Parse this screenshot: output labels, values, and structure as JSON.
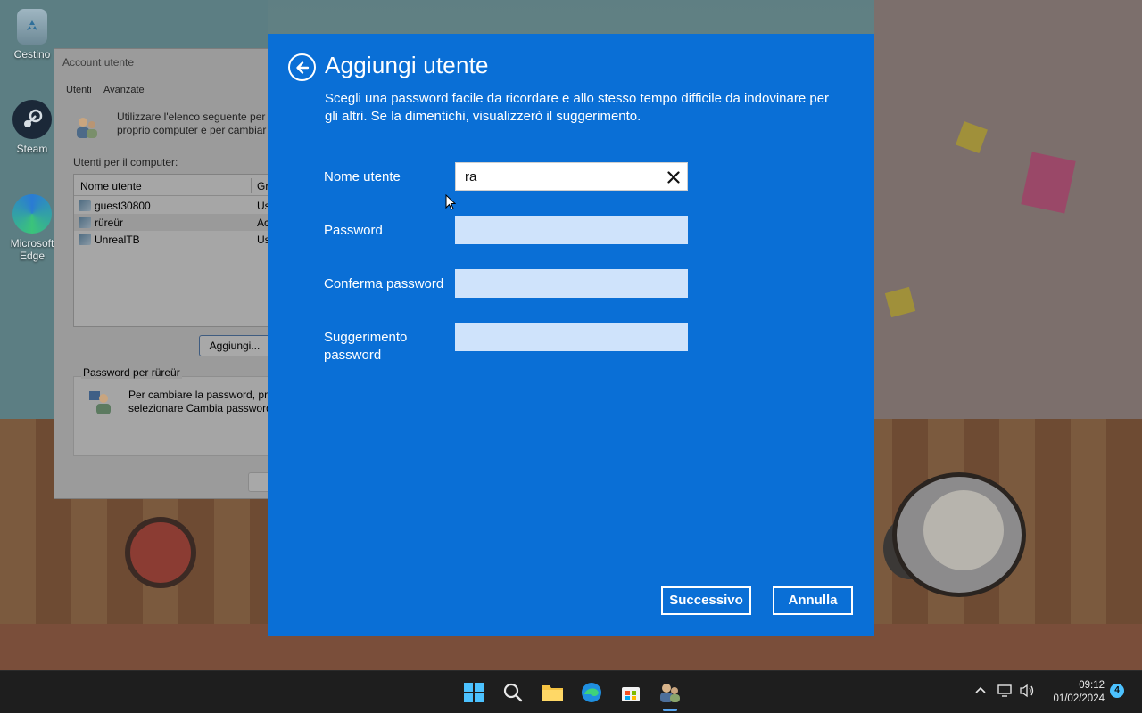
{
  "desktop": {
    "icons": [
      {
        "label": "Cestino",
        "icon": "recycle-bin-icon"
      },
      {
        "label": "Steam",
        "icon": "steam-icon"
      },
      {
        "label": "Microsoft Edge",
        "icon": "edge-icon"
      }
    ]
  },
  "account_window": {
    "title": "Account utente",
    "tabs": [
      "Utenti",
      "Avanzate"
    ],
    "intro_line1": "Utilizzare l'elenco seguente per c",
    "intro_line2": "proprio computer e per cambiar",
    "list_label": "Utenti per il computer:",
    "columns": [
      "Nome utente",
      "Gr"
    ],
    "users": [
      {
        "name": "guest30800",
        "group": "Us"
      },
      {
        "name": "rüreür",
        "group": "Ac"
      },
      {
        "name": "UnrealTB",
        "group": "Us"
      }
    ],
    "add_button": "Aggiungi...",
    "password_group_title": "Password per rüreür",
    "password_line1": "Per cambiare la password, pre",
    "password_line2": "selezionare Cambia password"
  },
  "dialog": {
    "title": "Aggiungi utente",
    "description": "Scegli una password facile da ricordare e allo stesso tempo difficile da indovinare per gli altri. Se la dimentichi, visualizzerò il suggerimento.",
    "fields": {
      "username_label": "Nome utente",
      "username_value": "ra",
      "password_label": "Password",
      "password_value": "",
      "confirm_label": "Conferma password",
      "confirm_value": "",
      "hint_label": "Suggerimento password",
      "hint_value": ""
    },
    "next_button": "Successivo",
    "cancel_button": "Annulla",
    "accent_color": "#0a6fd6"
  },
  "taskbar": {
    "apps": [
      "start-icon",
      "search-icon",
      "file-explorer-icon",
      "edge-icon",
      "store-icon",
      "user-accounts-icon"
    ],
    "time": "09:12",
    "date": "01/02/2024",
    "notification_count": "4"
  }
}
